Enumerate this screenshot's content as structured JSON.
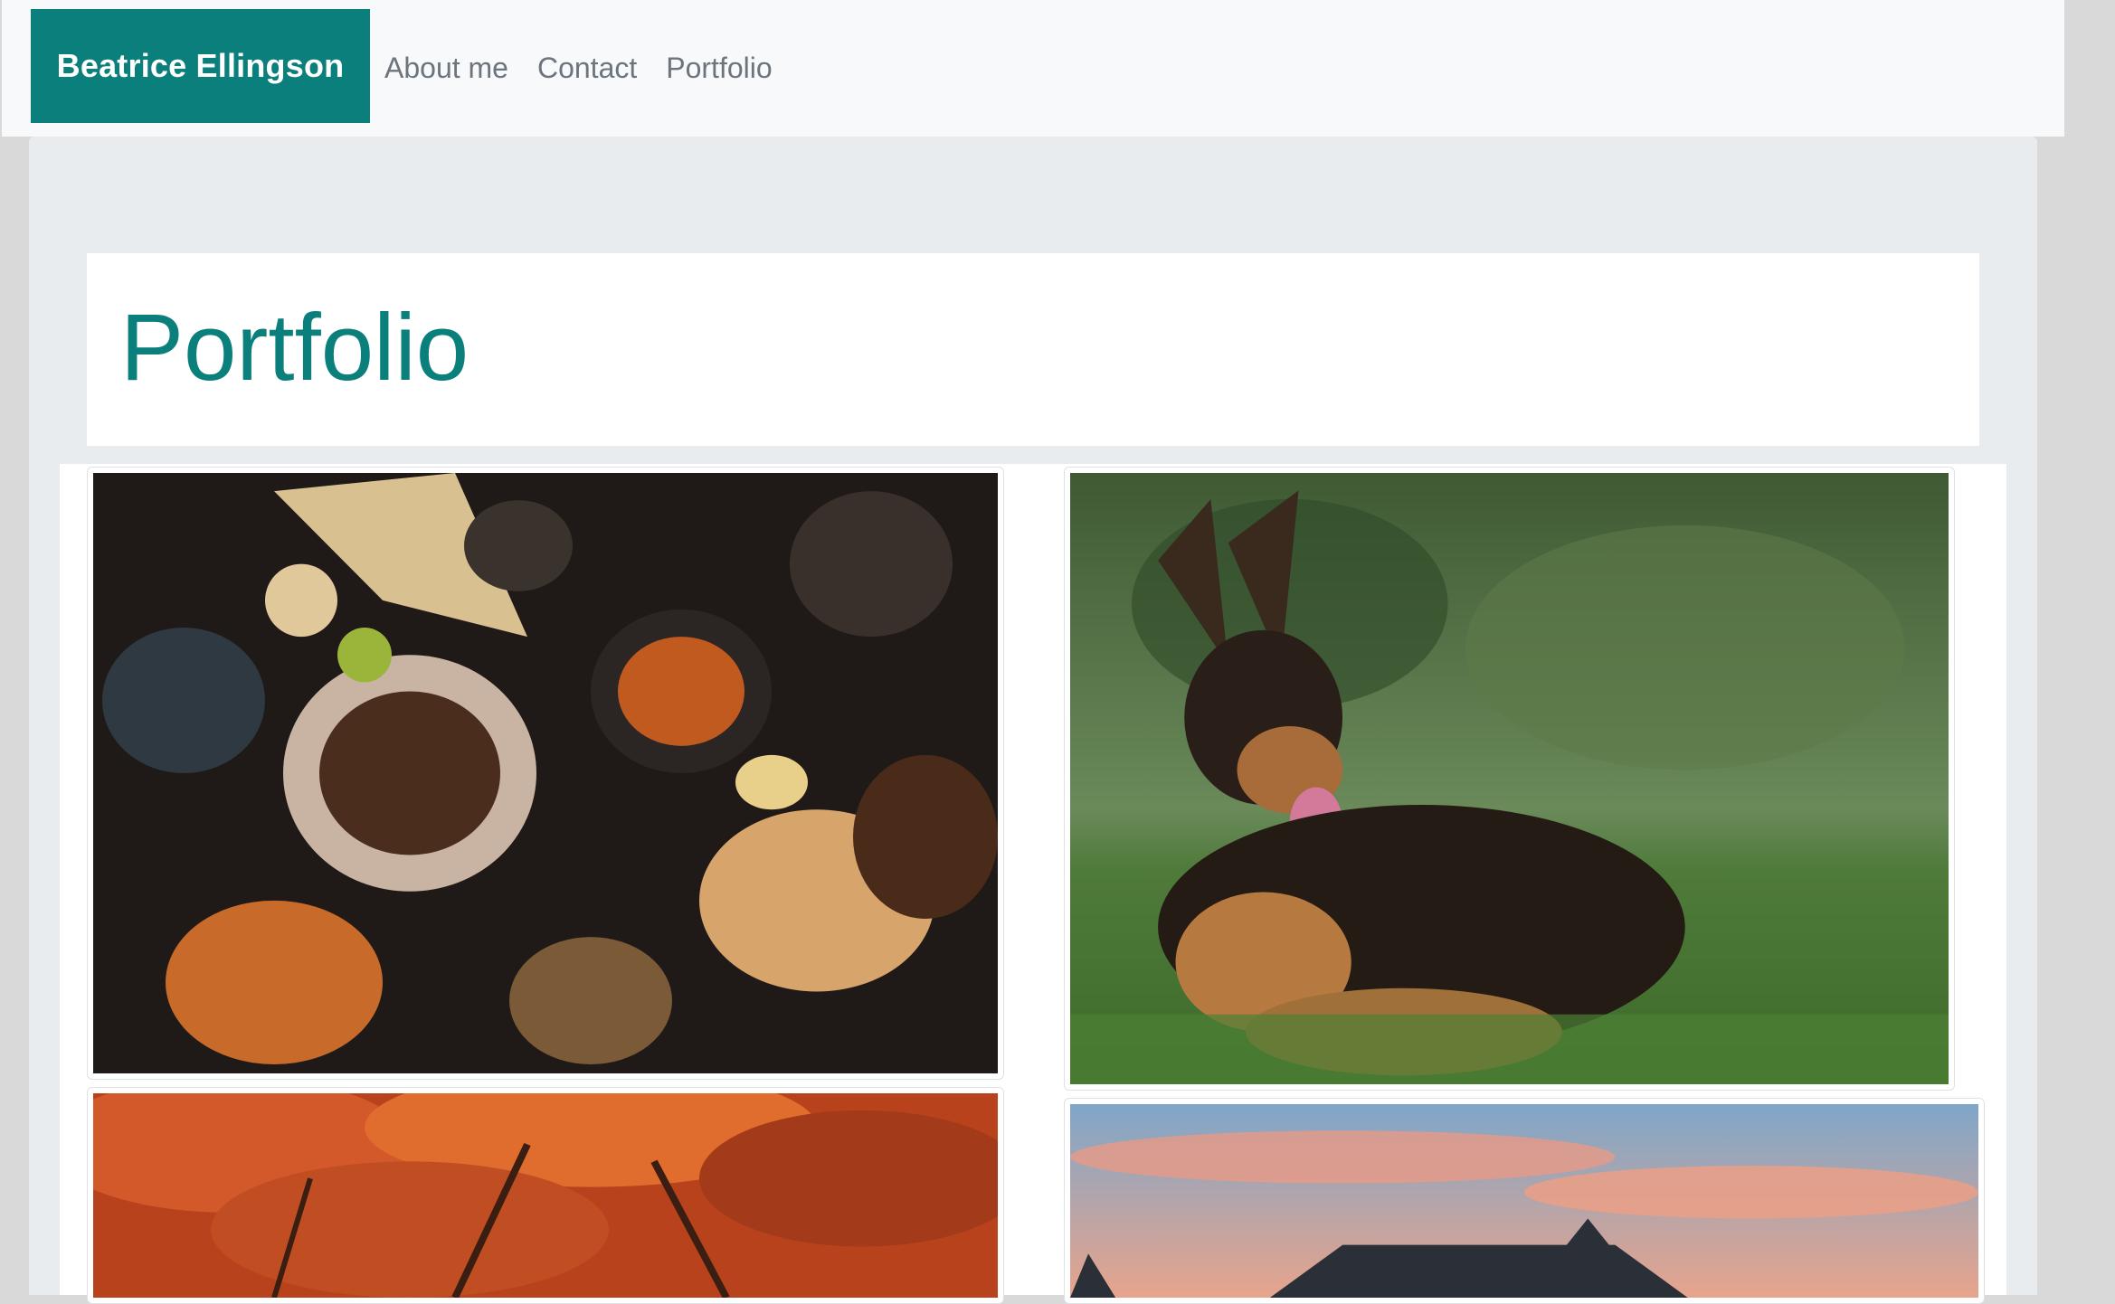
{
  "nav": {
    "brand": "Beatrice Ellingson",
    "links": [
      "About me",
      "Contact",
      "Portfolio"
    ]
  },
  "page": {
    "title": "Portfolio"
  },
  "colors": {
    "accent": "#0b7f7b",
    "nav_bg": "#f8f9fa",
    "jumbotron_bg": "#e9ecef"
  },
  "gallery": {
    "images": [
      {
        "subject": "food-spread"
      },
      {
        "subject": "german-shepherd-puppy"
      },
      {
        "subject": "autumn-trees"
      },
      {
        "subject": "house-sunset"
      }
    ]
  }
}
